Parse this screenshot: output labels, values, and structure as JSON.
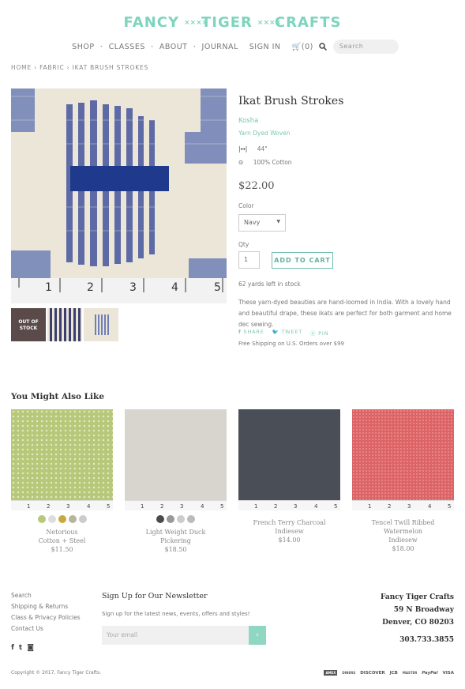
{
  "header": {
    "logo_left": "FANCY",
    "logo_mid": "TIGER",
    "logo_right": "CRAFTS",
    "logo_xx": "××××",
    "nav": [
      "SHOP",
      "CLASSES",
      "ABOUT",
      "JOURNAL",
      "SIGN IN"
    ],
    "cart_count": "(0)",
    "search_placeholder": "Search"
  },
  "breadcrumb": "HOME › FABRIC › IKAT BRUSH STROKES",
  "product": {
    "title": "Ikat Brush Strokes",
    "vendor": "Kosha",
    "type": "Yarn Dyed Woven",
    "width": "44\"",
    "content": "100% Cotton",
    "price": "$22.00",
    "color_label": "Color",
    "color_value": "Navy",
    "qty_label": "Qty",
    "qty_value": "1",
    "add_to_cart": "ADD TO CART",
    "stock": "62 yards left in stock",
    "description": "These yarn-dyed beauties are hand-loomed in India. With a lovely hand and beautiful drape, these ikats are perfect for both garment and home dec sewing.",
    "share": "SHARE",
    "tweet": "TWEET",
    "pin": "PIN",
    "shipping": "Free Shipping on U.S. Orders over $99",
    "out_of_stock": "OUT OF STOCK",
    "ruler_numbers": [
      "1",
      "2",
      "3",
      "4",
      "5"
    ]
  },
  "related": {
    "heading": "You Might Also Like",
    "items": [
      {
        "title1": "Netorious",
        "title2": "Cotton + Steel",
        "price": "$11.50",
        "color": "#b6c879"
      },
      {
        "title1": "Light Weight Duck",
        "title2": "Pickering",
        "price": "$18.50",
        "color": "#d8d5cf"
      },
      {
        "title1": "French Terry Charcoal",
        "title2": "Indiesew",
        "price": "$14.00",
        "color": "#4a4e57"
      },
      {
        "title1": "Tencel Twill Ribbed Watermelon",
        "title2": "Indiesew",
        "price": "$18.00",
        "color": "#dd6466"
      }
    ]
  },
  "footer": {
    "links": [
      "Search",
      "Shipping & Returns",
      "Class & Privacy Policies",
      "Contact Us"
    ],
    "newsletter_title": "Sign Up for Our Newsletter",
    "newsletter_text": "Sign up for the latest news, events, offers and styles!",
    "email_placeholder": "Your email",
    "store_name": "Fancy Tiger Crafts",
    "addr1": "59 N Broadway",
    "addr2": "Denver, CO 80203",
    "phone": "303.733.3855",
    "copyright": "Copyright © 2017, Fancy Tiger Crafts.",
    "payments": [
      "AMEX",
      "DINERS",
      "DISCOVER",
      "JCB",
      "MASTER",
      "PayPal",
      "VISA"
    ]
  },
  "colors": {
    "accent": "#7fd4be"
  }
}
